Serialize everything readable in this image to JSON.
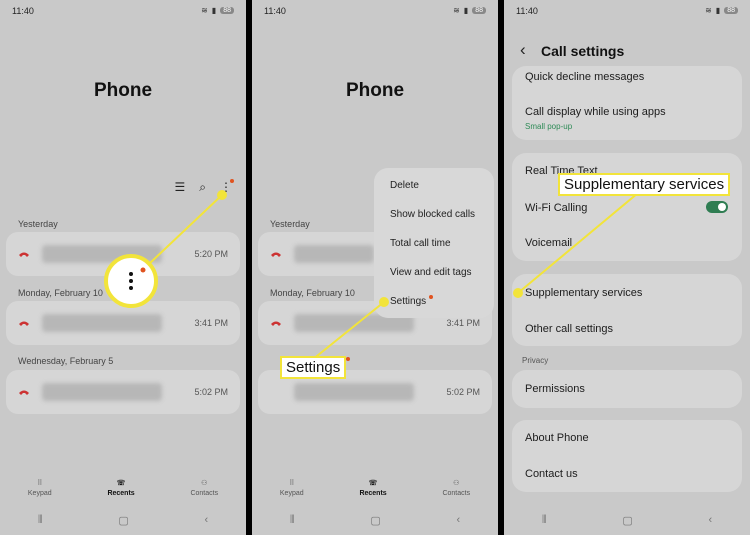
{
  "status": {
    "time": "11:40",
    "battery": "88"
  },
  "phone": {
    "title": "Phone",
    "sections": [
      "Yesterday",
      "Monday, February 10",
      "Wednesday, February 5"
    ],
    "calls": [
      {
        "time": "5:20 PM"
      },
      {
        "time": "3:41 PM"
      },
      {
        "time": "5:02 PM"
      }
    ],
    "nav": [
      "Keypad",
      "Recents",
      "Contacts"
    ]
  },
  "menu": {
    "items": [
      "Delete",
      "Show blocked calls",
      "Total call time",
      "View and edit tags",
      "Settings"
    ]
  },
  "callouts": {
    "settings": "Settings",
    "supplementary": "Supplementary services"
  },
  "call_settings": {
    "title": "Call settings",
    "items": {
      "quick_decline": "Quick decline messages",
      "call_display": "Call display while using apps",
      "call_display_sub": "Small pop-up",
      "rtt": "Real Time Text",
      "wifi": "Wi-Fi Calling",
      "voicemail": "Voicemail",
      "supplementary": "Supplementary services",
      "other": "Other call settings",
      "privacy_header": "Privacy",
      "permissions": "Permissions",
      "about": "About Phone",
      "contact": "Contact us"
    },
    "wifi_toggle_on": true
  },
  "colors": {
    "highlight": "#f2e43a",
    "accent": "#2f7d52",
    "badge": "#e0531f"
  }
}
